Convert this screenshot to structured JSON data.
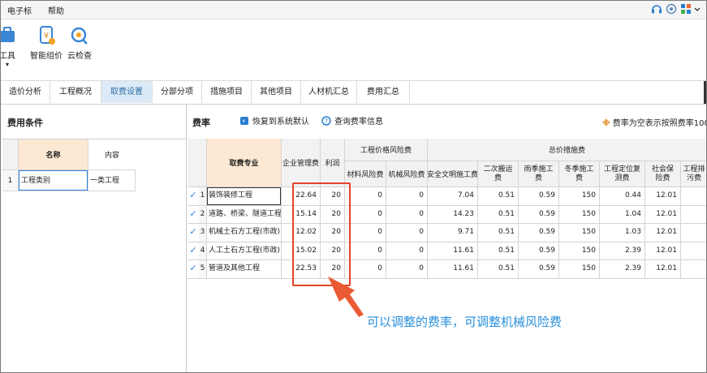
{
  "menubar": {
    "items": [
      "电子标",
      "帮助"
    ]
  },
  "ribbon": {
    "buttons": [
      {
        "label": "工具",
        "icon": "toolbox-icon"
      },
      {
        "label": "智能组价",
        "icon": "smart-pricing-icon"
      },
      {
        "label": "云检查",
        "icon": "cloud-check-icon"
      }
    ]
  },
  "tabs": [
    "造价分析",
    "工程概况",
    "取费设置",
    "分部分项",
    "措施项目",
    "其他项目",
    "人材机汇总",
    "费用汇总"
  ],
  "active_tab": "取费设置",
  "left": {
    "title": "费用条件",
    "headers": [
      "名称",
      "内容"
    ],
    "rows": [
      {
        "idx": "1",
        "name": "工程类别",
        "value": "一类工程"
      }
    ]
  },
  "right": {
    "title": "费率",
    "restore_label": "恢复到系统默认",
    "query_label": "查询费率信息",
    "note": "费率为空表示按照费率100%"
  },
  "table": {
    "headers": {
      "name": "取费专业",
      "mgmt": "企业管理费",
      "profit": "利润",
      "risk_group": "工程价格风险费",
      "material_risk": "材料风险费",
      "machine_risk": "机械风险费",
      "measure_group": "总价措施费",
      "safe": "安全文明施工费",
      "second": "二次搬运费",
      "rain": "雨季施工费",
      "winter": "冬季施工费",
      "locate": "工程定位复测费",
      "social": "社会保险费",
      "last": "工程排污费"
    },
    "rows": [
      {
        "idx": "1",
        "name": "装饰装修工程",
        "mgmt": "22.64",
        "profit": "20",
        "material_risk": "0",
        "machine_risk": "0",
        "safe": "7.04",
        "second": "0.51",
        "rain": "0.59",
        "winter": "150",
        "locate": "0.44",
        "social": "12.01"
      },
      {
        "idx": "2",
        "name": "道路、桥梁、隧道工程",
        "mgmt": "15.14",
        "profit": "20",
        "material_risk": "0",
        "machine_risk": "0",
        "safe": "14.23",
        "second": "0.51",
        "rain": "0.59",
        "winter": "150",
        "locate": "1.04",
        "social": "12.01"
      },
      {
        "idx": "3",
        "name": "机械土石方工程(市政)",
        "mgmt": "12.02",
        "profit": "20",
        "material_risk": "0",
        "machine_risk": "0",
        "safe": "9.71",
        "second": "0.51",
        "rain": "0.59",
        "winter": "150",
        "locate": "1.03",
        "social": "12.01"
      },
      {
        "idx": "4",
        "name": "人工土石方工程(市政)",
        "mgmt": "15.02",
        "profit": "20",
        "material_risk": "0",
        "machine_risk": "0",
        "safe": "11.61",
        "second": "0.51",
        "rain": "0.59",
        "winter": "150",
        "locate": "2.39",
        "social": "12.01"
      },
      {
        "idx": "5",
        "name": "管道及其他工程",
        "mgmt": "22.53",
        "profit": "20",
        "material_risk": "0",
        "machine_risk": "0",
        "safe": "11.61",
        "second": "0.51",
        "rain": "0.59",
        "winter": "150",
        "locate": "2.39",
        "social": "12.01"
      }
    ]
  },
  "annotation": {
    "text": "可以调整的费率，可调整机械风险费",
    "color": "#2a8fdb",
    "box_color": "#e4432a"
  }
}
